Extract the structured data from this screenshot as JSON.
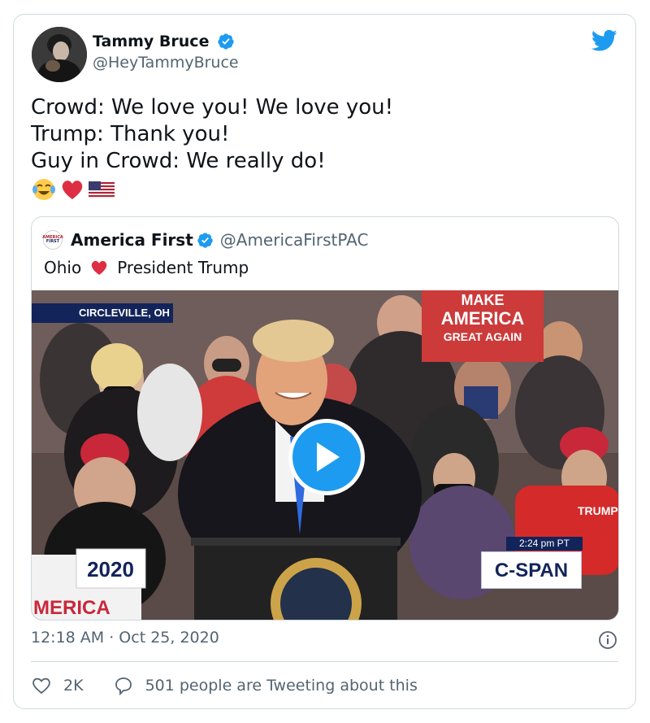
{
  "tweet": {
    "author": {
      "display_name": "Tammy Bruce",
      "handle": "@HeyTammyBruce",
      "verified": true
    },
    "text_lines": [
      "Crowd: We love you! We love you!",
      "Trump: Thank you!",
      "Guy in Crowd: We really do!"
    ],
    "emojis": [
      "face-with-tears-of-joy",
      "red-heart",
      "us-flag"
    ],
    "timestamp": "12:18 AM · Oct 25, 2020",
    "likes": "2K",
    "conversation": "501 people are Tweeting about this"
  },
  "quoted_tweet": {
    "author": {
      "display_name": "America First",
      "handle": "@AmericaFirstPAC",
      "verified": true,
      "avatar_text": [
        "AMERICA",
        "FIRST"
      ]
    },
    "text_before": "Ohio",
    "text_after": "President Trump",
    "video": {
      "location_label": "CIRCLEVILLE, OH",
      "time_label": "2:24 pm PT",
      "network_label": "C-SPAN",
      "banner_text": [
        "MAKE",
        "AMERICA",
        "GREAT AGAIN"
      ],
      "sign_text": [
        "2020",
        "MERICA"
      ],
      "shirt_text": "TRUMP"
    }
  },
  "colors": {
    "accent": "#1d9bf0",
    "heart": "#dd2e44",
    "text_secondary": "#536471",
    "border": "#cfd9de"
  }
}
